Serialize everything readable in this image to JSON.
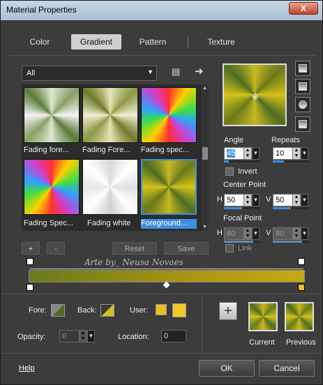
{
  "window": {
    "title": "Material Properties",
    "close_label": "X"
  },
  "tabs": [
    "Color",
    "Gradient",
    "Pattern",
    "Texture"
  ],
  "active_tab": "Gradient",
  "category_select": {
    "value": "All"
  },
  "thumbnails": [
    {
      "label": "Fading fore..."
    },
    {
      "label": "Fading Fore..."
    },
    {
      "label": "Fading spec..."
    },
    {
      "label": "Fading Spec..."
    },
    {
      "label": "Fading white"
    },
    {
      "label": "Foreground..."
    }
  ],
  "list_buttons": {
    "add": "+",
    "remove": "-",
    "reset": "Reset",
    "save": "Save"
  },
  "angle": {
    "label": "Angle",
    "value": "45"
  },
  "repeats": {
    "label": "Repeats",
    "value": "10"
  },
  "invert": {
    "label": "Invert"
  },
  "center_point": {
    "label": "Center Point",
    "h_label": "H",
    "h_value": "50",
    "v_label": "V",
    "v_value": "50"
  },
  "focal_point": {
    "label": "Focal Point",
    "h_label": "H",
    "h_value": "80",
    "v_label": "V",
    "v_value": "80"
  },
  "link": {
    "label": "Link"
  },
  "watermark": "Arte by_ Neusa Novaes",
  "fore": {
    "label": "Fore:"
  },
  "back": {
    "label": "Back:"
  },
  "user": {
    "label": "User:"
  },
  "opacity": {
    "label": "Opacity:",
    "value": "0"
  },
  "location": {
    "label": "Location:",
    "value": "0"
  },
  "current_label": "Current",
  "previous_label": "Previous",
  "help_label": "Help",
  "ok_label": "OK",
  "cancel_label": "Cancel",
  "colors": {
    "accent": "#3c8fe0",
    "gold": "#d4c21a",
    "olive": "#6a7a1c"
  }
}
